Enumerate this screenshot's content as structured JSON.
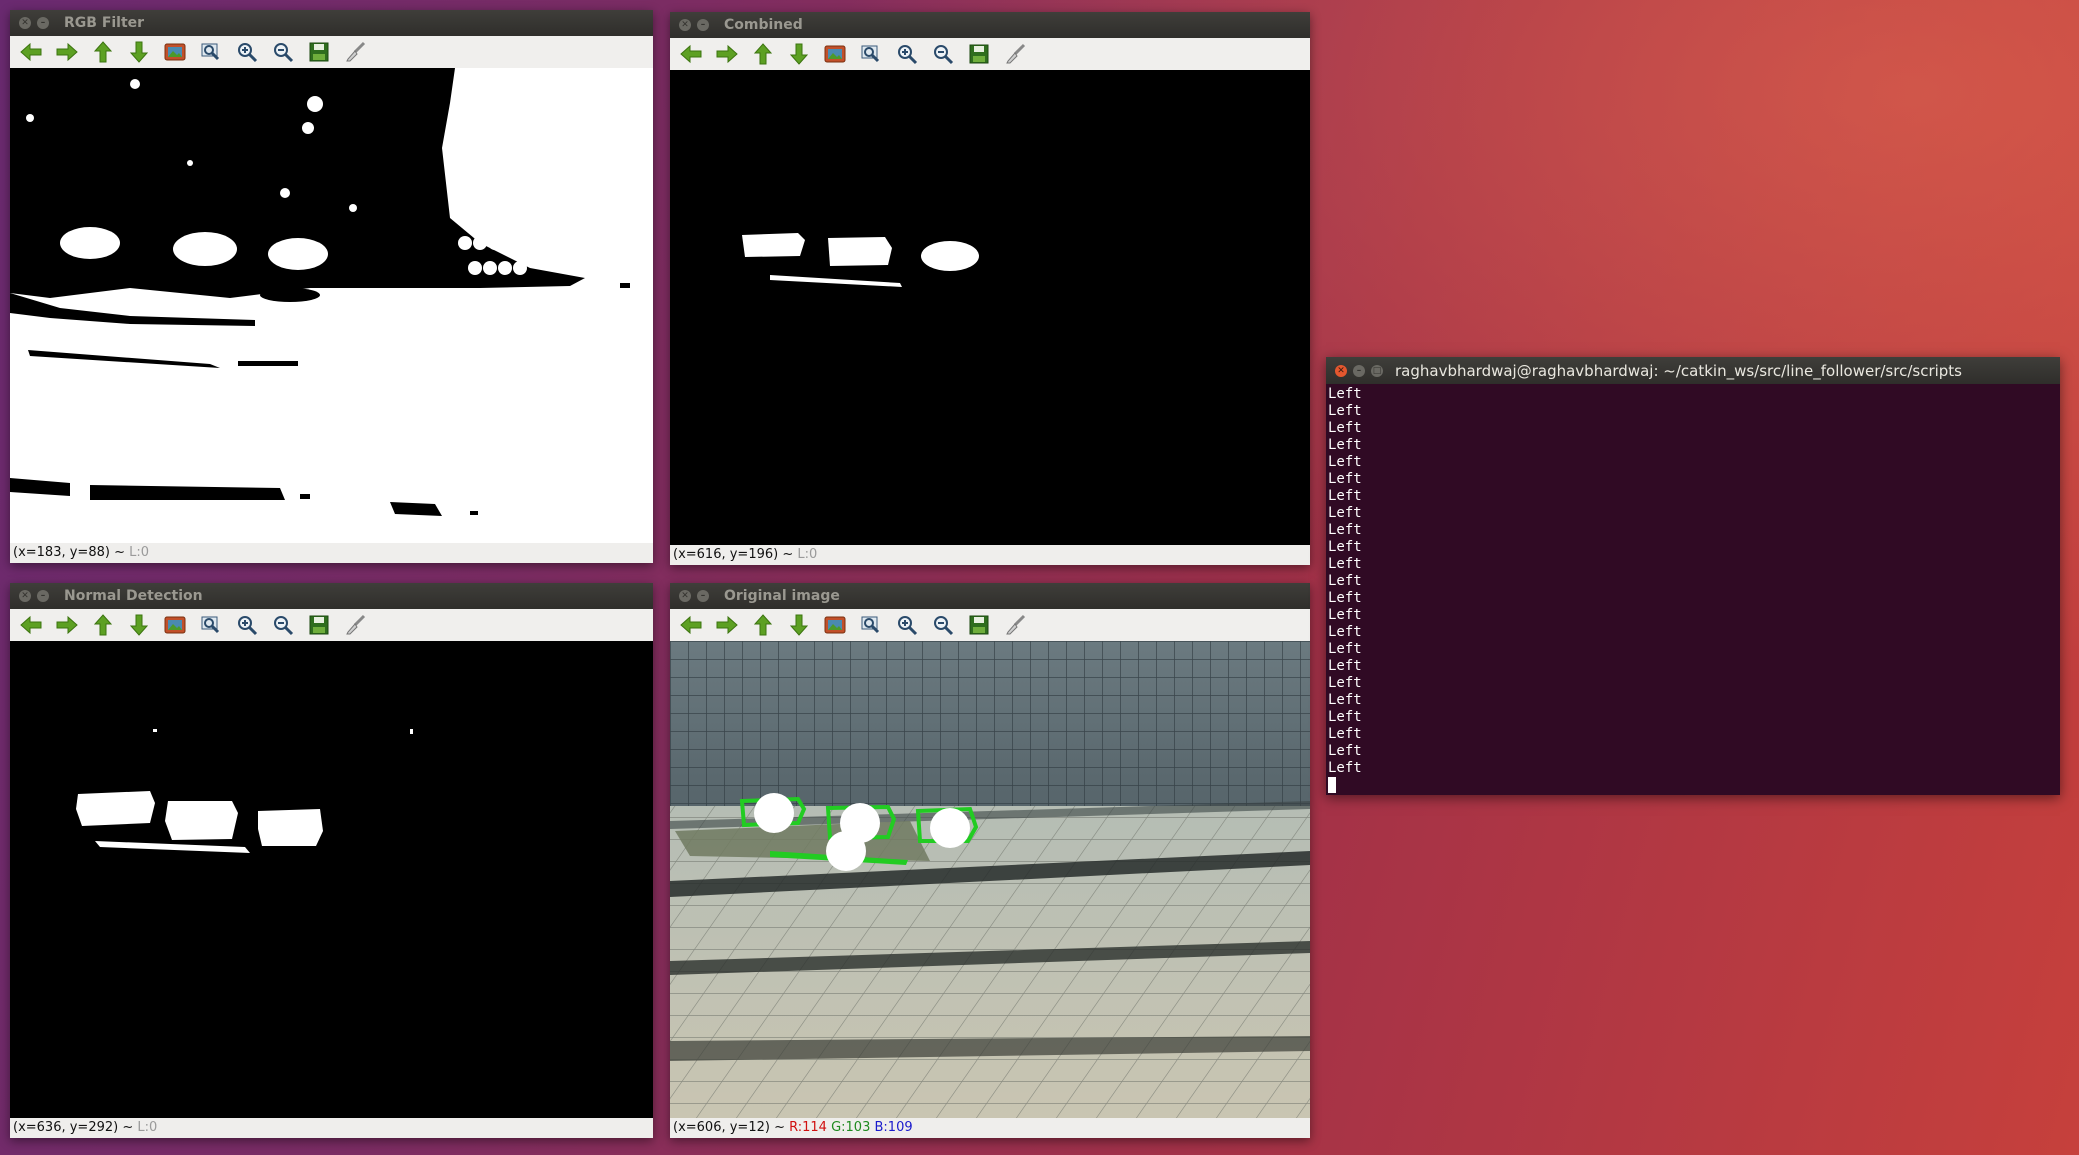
{
  "windows": {
    "rgb_filter": {
      "title": "RGB Filter",
      "status_coords": "(x=183, y=88) ~",
      "status_extra": "L:0"
    },
    "combined": {
      "title": "Combined",
      "status_coords": "(x=616, y=196) ~",
      "status_extra": "L:0"
    },
    "normal_detection": {
      "title": "Normal Detection",
      "status_coords": "(x=636, y=292) ~",
      "status_extra": "L:0"
    },
    "original_image": {
      "title": "Original image",
      "status_coords": "(x=606, y=12) ~",
      "r": "R:114",
      "g": "G:103",
      "b": "B:109"
    }
  },
  "toolbar_icons": [
    "arrow-left-icon",
    "arrow-right-icon",
    "arrow-up-icon",
    "arrow-down-icon",
    "image-icon",
    "zoom-fit-icon",
    "zoom-in-icon",
    "zoom-out-icon",
    "save-icon",
    "brush-icon"
  ],
  "terminal": {
    "title": "raghavbhardwaj@raghavbhardwaj: ~/catkin_ws/src/line_follower/src/scripts",
    "lines": [
      "Left",
      "Left",
      "Left",
      "Left",
      "Left",
      "Left",
      "Left",
      "Left",
      "Left",
      "Left",
      "Left",
      "Left",
      "Left",
      "Left",
      "Left",
      "Left",
      "Left",
      "Left",
      "Left",
      "Left",
      "Left",
      "Left",
      "Left"
    ]
  },
  "colors": {
    "terminal_bg": "#300a24",
    "detection_green": "#22cc22"
  }
}
